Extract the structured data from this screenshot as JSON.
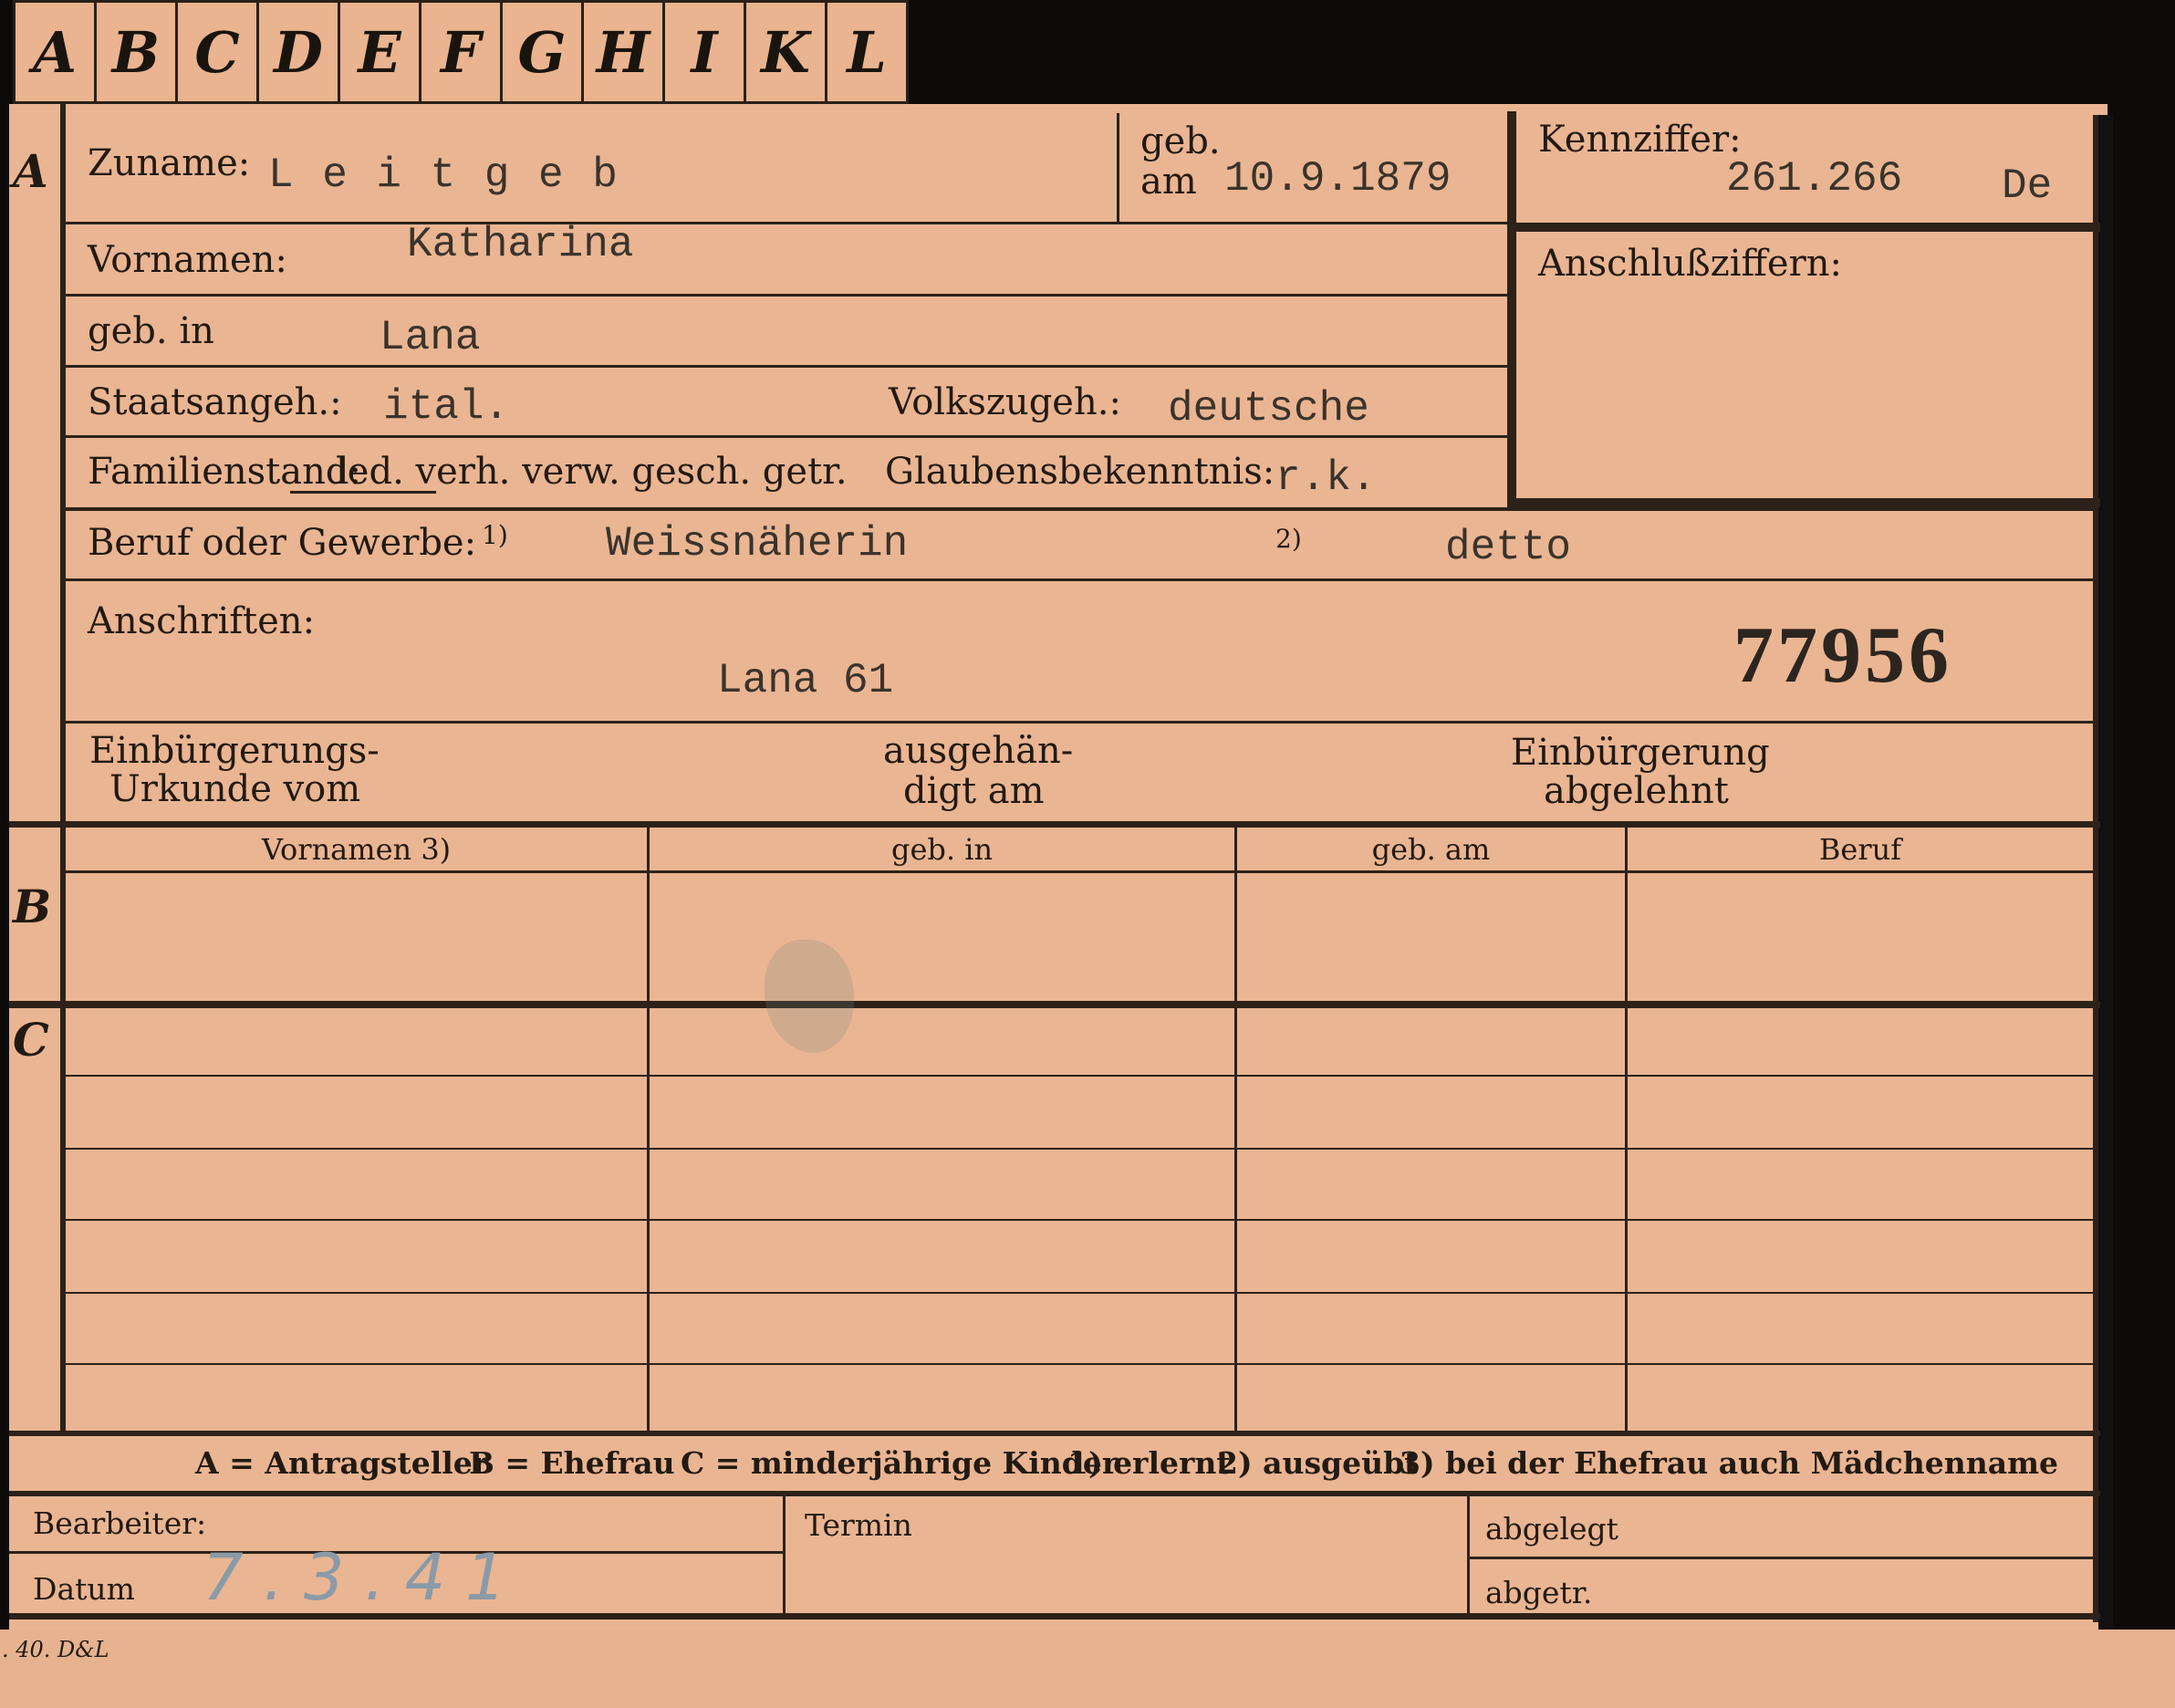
{
  "tabs": [
    "A",
    "B",
    "C",
    "D",
    "E",
    "F",
    "G",
    "H",
    "I",
    "K",
    "L"
  ],
  "sections": {
    "a": "A",
    "b": "B",
    "c": "C"
  },
  "fields": {
    "zuname_label": "Zuname:",
    "zuname_value": "L e i t g e b",
    "geb_label": "geb.",
    "am_label": "am",
    "geb_am_value": "10.9.1879",
    "kennziffer_label": "Kennziffer:",
    "kennziffer_value": "261.266",
    "kennziffer_suffix": "De",
    "anschlussziffern_label": "Anschlußziffern:",
    "vornamen_label": "Vornamen:",
    "vornamen_value": "Katharina",
    "geb_in_label": "geb. in",
    "geb_in_value": "Lana",
    "staatsangeh_label": "Staatsangeh.:",
    "staatsangeh_value": "ital.",
    "volkszugeh_label": "Volkszugeh.:",
    "volkszugeh_value": "deutsche",
    "familienstand_label": "Familienstand:",
    "familienstand_options": "led. verh. verw. gesch. getr.",
    "glaubens_label": "Glaubensbekenntnis:",
    "glaubens_value": "r.k.",
    "beruf_label": "Beruf oder Gewerbe:",
    "beruf_mark1": "1)",
    "beruf_value1": "Weissnäherin",
    "beruf_mark2": "2)",
    "beruf_value2": "detto",
    "anschriften_label": "Anschriften:",
    "anschriften_value": "Lana 61",
    "stamp_number": "77956",
    "einbuergerungs_l1": "Einbürgerungs-",
    "einbuergerungs_l2": "Urkunde vom",
    "ausgehaen_l1": "ausgehän-",
    "ausgehaen_l2": "digt am",
    "einbuergerung_l1": "Einbürgerung",
    "einbuergerung_l2": "abgelehnt"
  },
  "table_headers": [
    "Vornamen 3)",
    "geb. in",
    "geb. am",
    "Beruf"
  ],
  "legend": {
    "a": "A = Antragsteller",
    "b": "B = Ehefrau",
    "c": "C = minderjährige Kinder",
    "n1": "1) erlernt",
    "n2": "2) ausgeübt",
    "n3": "3) bei der Ehefrau auch Mädchenname"
  },
  "footer": {
    "bearbeiter_label": "Bearbeiter:",
    "datum_label": "Datum",
    "datum_value": "7.3.41",
    "termin_label": "Termin",
    "abgelegt_label": "abgelegt",
    "abgetr_label": "abgetr.",
    "print_code": ". 40. D&L"
  },
  "colors": {
    "card": "#eab592",
    "ink": "#2c221a",
    "typewriter": "#3a332c",
    "pencil": "#8a9aa8"
  }
}
